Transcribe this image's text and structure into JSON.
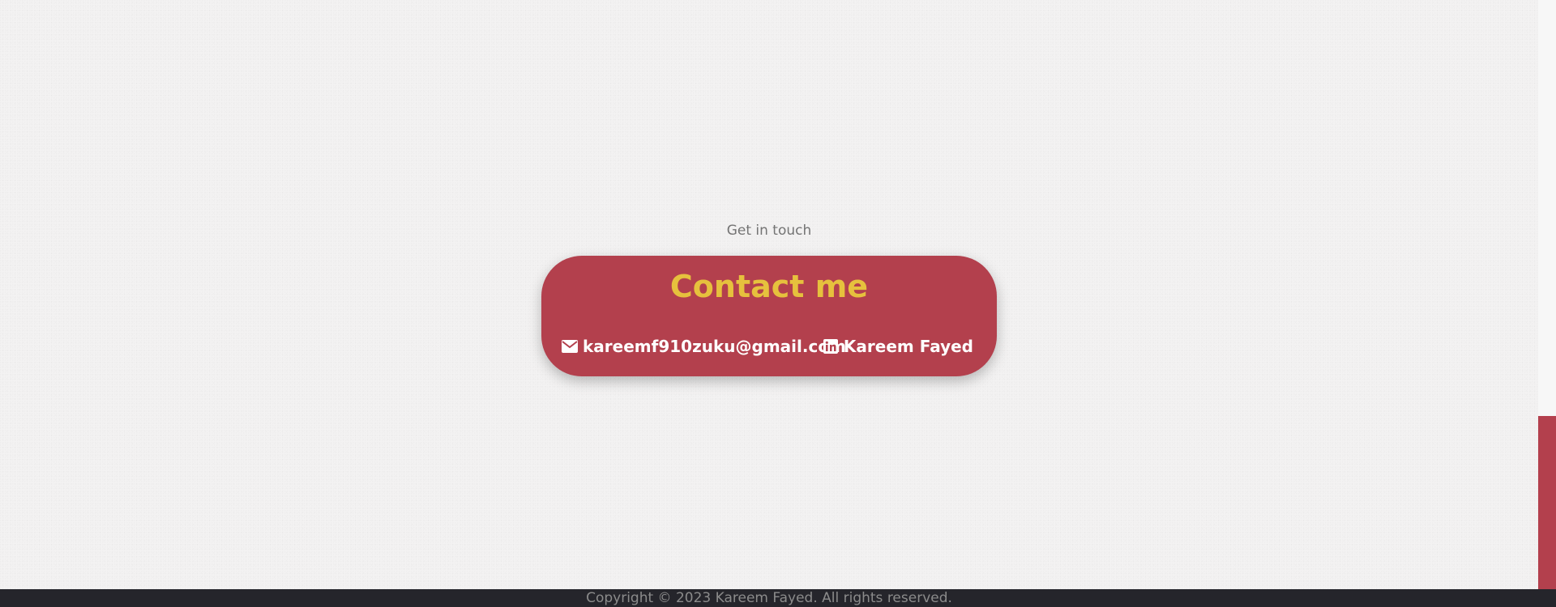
{
  "contact": {
    "subtitle": "Get in touch",
    "title": "Contact me",
    "email": {
      "icon": "envelope-icon",
      "label": "kareemf910zuku@gmail.com"
    },
    "linkedin": {
      "icon": "linkedin-icon",
      "label": "Kareem Fayed"
    }
  },
  "footer": {
    "copyright": "Copyright © 2023 Kareem Fayed. All rights reserved."
  },
  "colors": {
    "background": "#f3f2f2",
    "card": "#b3404d",
    "title": "#e6c13d",
    "footer": "#25252b",
    "scrollbar_thumb": "#b3404d"
  }
}
